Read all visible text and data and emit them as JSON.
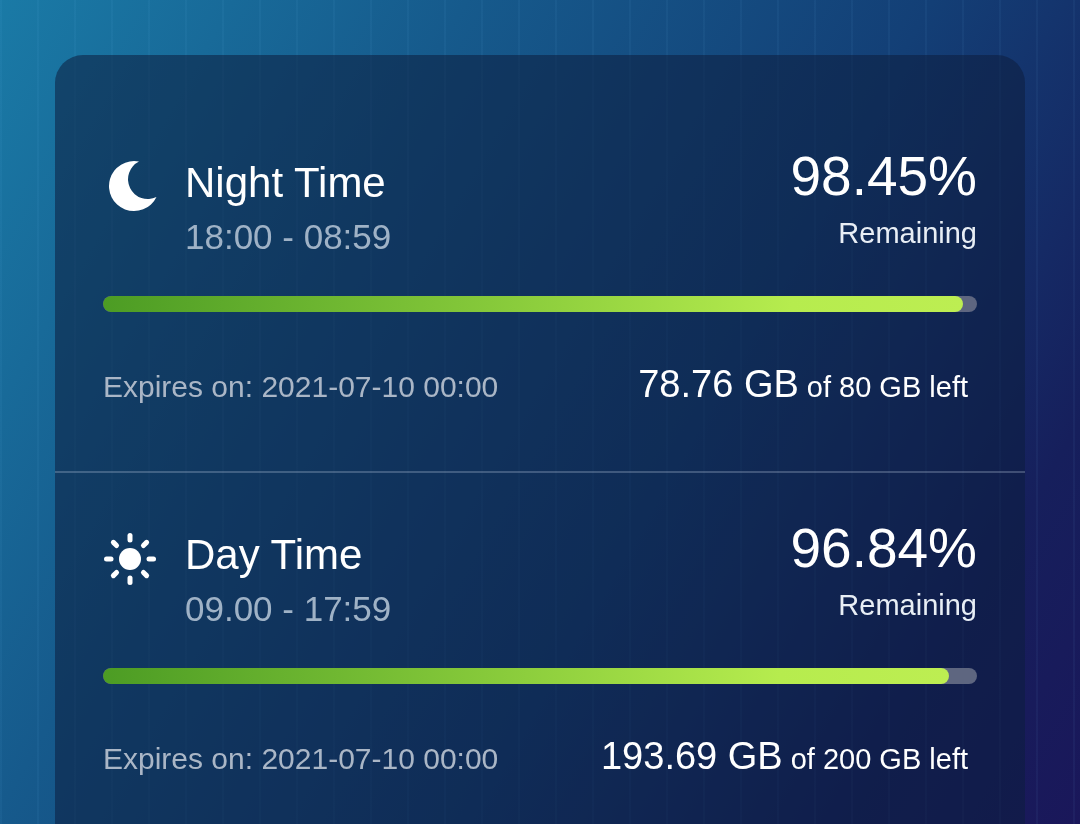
{
  "plans": [
    {
      "kind": "night",
      "title": "Night Time",
      "hours": "18:00 - 08:59",
      "percent": "98.45%",
      "percent_caption": "Remaining",
      "level": 0.9845,
      "expires": "Expires on: 2021-07-10 00:00",
      "amount": "78.76 GB",
      "amount_suffix": "of 80 GB left"
    },
    {
      "kind": "day",
      "title": "Day Time",
      "hours": "09.00 - 17:59",
      "percent": "96.84%",
      "percent_caption": "Remaining",
      "level": 0.9684,
      "expires": "Expires on: 2021-07-10 00:00",
      "amount": "193.69 GB",
      "amount_suffix": "of 200 GB left"
    }
  ]
}
